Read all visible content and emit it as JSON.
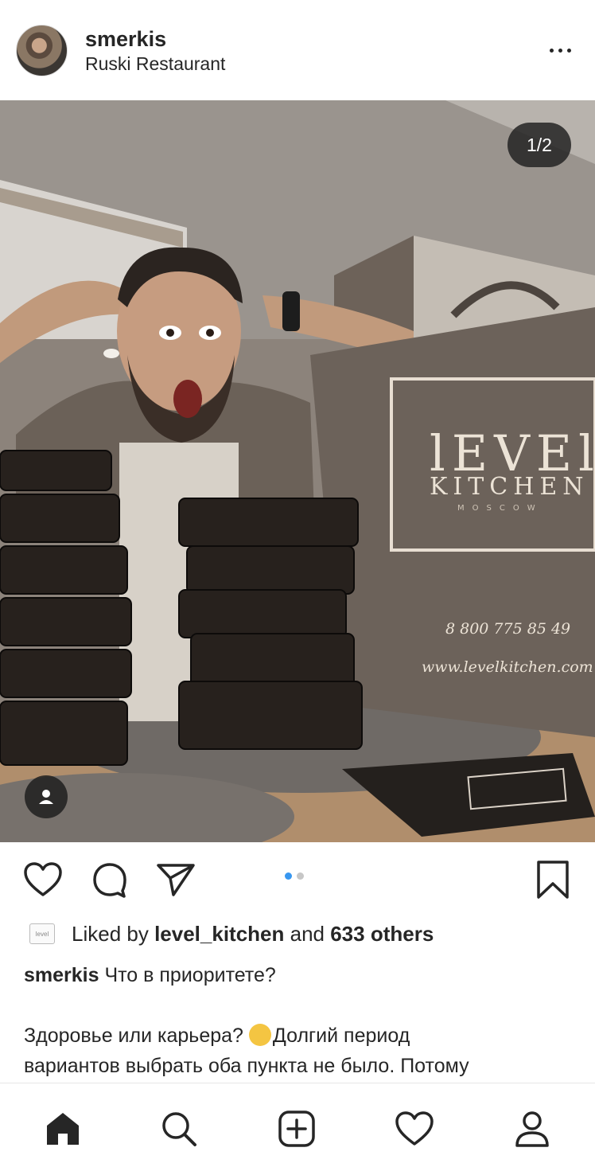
{
  "post": {
    "username": "smerkis",
    "location": "Ruski Restaurant",
    "counter": "1/2",
    "liked_by_prefix": "Liked by ",
    "liked_by_user": "level_kitchen",
    "liked_by_and": " and ",
    "liked_by_others": "633 others",
    "liked_badge": "level",
    "caption_user": "smerkis",
    "caption_line1": " Что в приоритете?",
    "caption_line2a": "Здоровье или карьера? ",
    "caption_line2b": "Долгий период",
    "caption_line3": "вариантов выбрать оба пункта не было. Потому"
  },
  "photo": {
    "bag_brand_line1": "lEVEl",
    "bag_brand_line2": "KITCHEN",
    "bag_brand_city": "MOSCOW",
    "bag_phone": "8 800 775 85 49",
    "bag_url": "www.levelkitchen.com"
  },
  "carousel": {
    "total_slides": 2,
    "active_slide": 1
  },
  "colors": {
    "accent": "#3897f0",
    "text": "#262626",
    "icon": "#262626"
  },
  "icons": {
    "more": "more-dots-icon",
    "like": "heart-icon",
    "comment": "comment-icon",
    "share": "send-icon",
    "save": "bookmark-icon",
    "tag": "user-tag-icon",
    "home": "home-icon",
    "search": "search-icon",
    "add": "add-post-icon",
    "activity": "heart-icon",
    "profile": "profile-icon"
  }
}
